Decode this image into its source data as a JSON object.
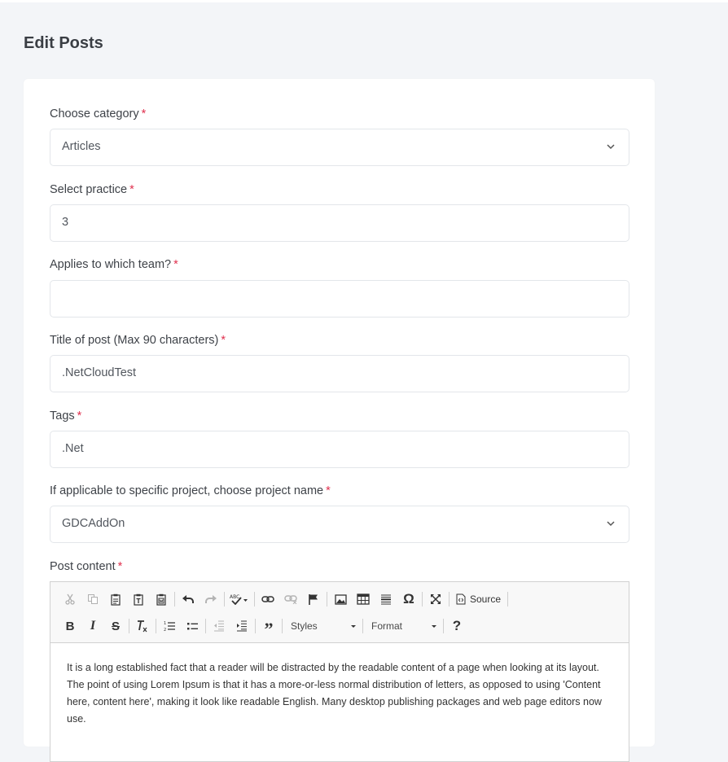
{
  "page": {
    "title": "Edit Posts"
  },
  "form": {
    "required_mark": "*",
    "category": {
      "label": "Choose category",
      "value": "Articles"
    },
    "practice": {
      "label": "Select practice",
      "value": "3"
    },
    "team": {
      "label": "Applies to which team?",
      "value": ""
    },
    "post_title": {
      "label": "Title of post (Max 90 characters)",
      "value": ".NetCloudTest"
    },
    "tags": {
      "label": "Tags",
      "value": ".Net"
    },
    "project": {
      "label": "If applicable to specific project, choose project name",
      "value": "GDCAddOn"
    },
    "content": {
      "label": "Post content"
    }
  },
  "editor": {
    "toolbar": {
      "source_label": "Source",
      "styles_label": "Styles",
      "format_label": "Format",
      "help_label": "?"
    },
    "body_text": "It is a long established fact that a reader will be distracted by the readable content of a page when looking at its layout. The point of using Lorem Ipsum is that it has a more-or-less normal distribution of letters, as opposed to using 'Content here, content here', making it look like readable English. Many desktop publishing packages and web page editors now use."
  },
  "icons": {
    "row1": [
      "cut-icon",
      "copy-icon",
      "paste-icon",
      "paste-text-icon",
      "paste-word-icon",
      "undo-icon",
      "redo-icon",
      "spellcheck-icon",
      "link-icon",
      "unlink-icon",
      "anchor-flag-icon",
      "image-icon",
      "table-icon",
      "horizontal-rule-icon",
      "special-char-omega-icon",
      "maximize-icon",
      "source-icon"
    ],
    "row2": [
      "bold-icon",
      "italic-icon",
      "strike-icon",
      "remove-format-icon",
      "numbered-list-icon",
      "bulleted-list-icon",
      "outdent-icon",
      "indent-icon",
      "blockquote-icon",
      "styles-dropdown",
      "format-dropdown",
      "help-icon"
    ]
  },
  "colors": {
    "required": "#e0304e",
    "background": "#f3f5f8",
    "card": "#ffffff",
    "border": "#e3e6ea"
  }
}
